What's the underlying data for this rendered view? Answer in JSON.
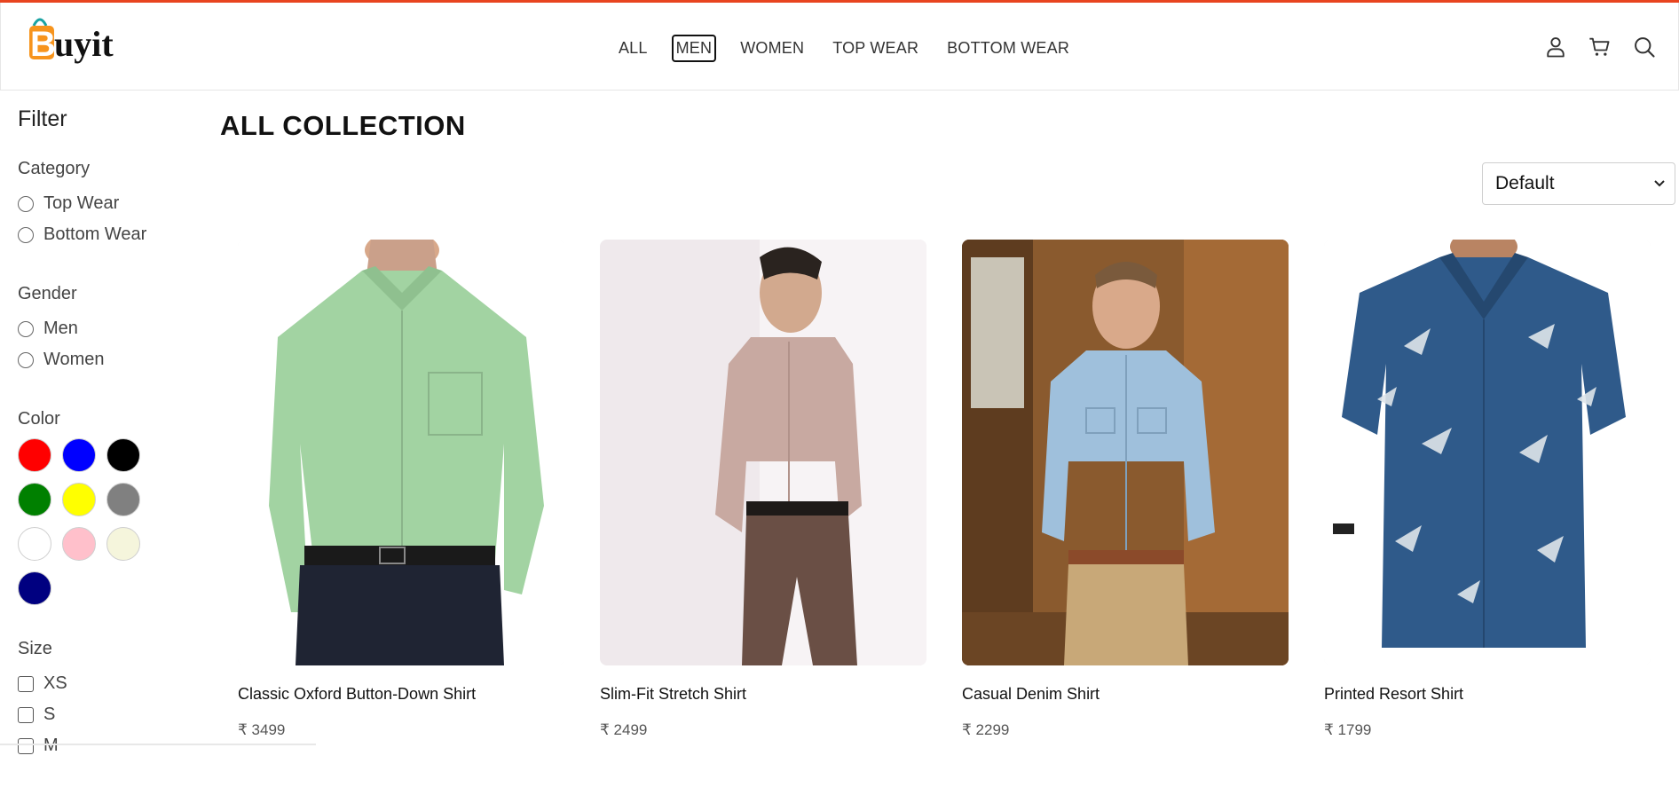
{
  "brand": {
    "logo_text": "Buyit",
    "accent_color": "#e8441f",
    "logo_bag_color": "#f7941d",
    "logo_handle_color": "#1aa3a3"
  },
  "nav": {
    "items": [
      {
        "label": "ALL",
        "active": false
      },
      {
        "label": "MEN",
        "active": true
      },
      {
        "label": "WOMEN",
        "active": false
      },
      {
        "label": "TOP WEAR",
        "active": false
      },
      {
        "label": "BOTTOM WEAR",
        "active": false
      }
    ],
    "icons": [
      "user-icon",
      "cart-icon",
      "search-icon"
    ]
  },
  "filter": {
    "title": "Filter",
    "category": {
      "label": "Category",
      "options": [
        "Top Wear",
        "Bottom Wear"
      ]
    },
    "gender": {
      "label": "Gender",
      "options": [
        "Men",
        "Women"
      ]
    },
    "color": {
      "label": "Color",
      "swatches": [
        {
          "name": "red",
          "hex": "#ff0000"
        },
        {
          "name": "blue",
          "hex": "#0000ff"
        },
        {
          "name": "black",
          "hex": "#000000"
        },
        {
          "name": "green",
          "hex": "#008000"
        },
        {
          "name": "yellow",
          "hex": "#ffff00"
        },
        {
          "name": "gray",
          "hex": "#808080"
        },
        {
          "name": "white",
          "hex": "#ffffff"
        },
        {
          "name": "pink",
          "hex": "#ffc0cb"
        },
        {
          "name": "beige",
          "hex": "#f5f5dc"
        },
        {
          "name": "navy",
          "hex": "#000080"
        }
      ]
    },
    "size": {
      "label": "Size",
      "options": [
        "XS",
        "S",
        "M"
      ]
    }
  },
  "main": {
    "title": "ALL COLLECTION",
    "sort": {
      "selected": "Default"
    },
    "products": [
      {
        "name": "Classic Oxford Button-Down Shirt",
        "price": "₹ 3499"
      },
      {
        "name": "Slim-Fit Stretch Shirt",
        "price": "₹ 2499"
      },
      {
        "name": "Casual Denim Shirt",
        "price": "₹ 2299"
      },
      {
        "name": "Printed Resort Shirt",
        "price": "₹ 1799"
      }
    ]
  }
}
